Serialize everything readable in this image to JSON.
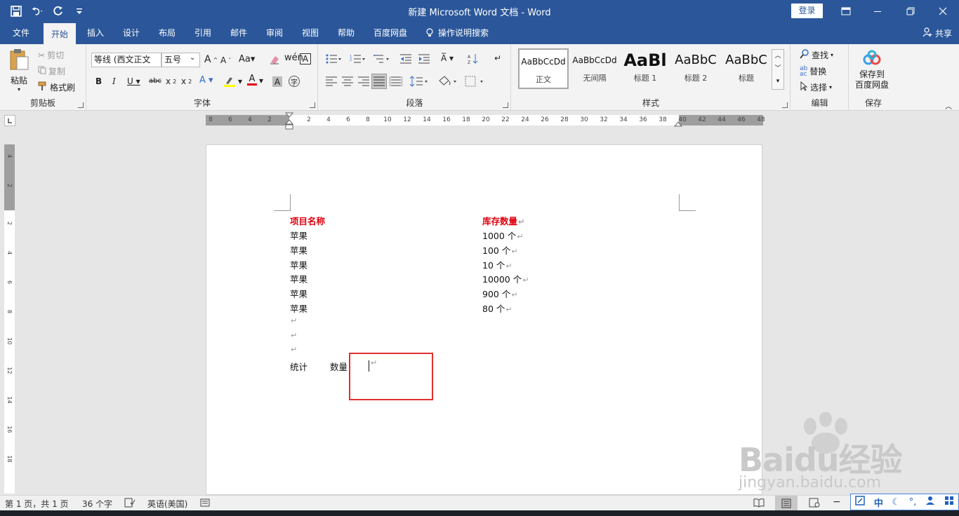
{
  "window": {
    "title": "新建 Microsoft Word 文档  -  Word",
    "login": "登录"
  },
  "tabs": [
    {
      "label": "文件"
    },
    {
      "label": "开始"
    },
    {
      "label": "插入"
    },
    {
      "label": "设计"
    },
    {
      "label": "布局"
    },
    {
      "label": "引用"
    },
    {
      "label": "邮件"
    },
    {
      "label": "审阅"
    },
    {
      "label": "视图"
    },
    {
      "label": "帮助"
    },
    {
      "label": "百度网盘"
    },
    {
      "label": "操作说明搜索"
    }
  ],
  "share": "共享",
  "ribbon": {
    "clipboard": {
      "label": "剪贴板",
      "paste": "粘贴",
      "cut": "剪切",
      "copy": "复制",
      "format_painter": "格式刷"
    },
    "font": {
      "label": "字体",
      "font_name": "等线 (西文正文",
      "font_size": "五号"
    },
    "paragraph": {
      "label": "段落"
    },
    "styles": {
      "label": "样式",
      "items": [
        {
          "preview": "AaBbCcDd",
          "name": "正文"
        },
        {
          "preview": "AaBbCcDd",
          "name": "无间隔"
        },
        {
          "preview": "AaBl",
          "name": "标题 1"
        },
        {
          "preview": "AaBbC",
          "name": "标题 2"
        },
        {
          "preview": "AaBbC",
          "name": "标题"
        }
      ]
    },
    "editing": {
      "label": "编辑",
      "find": "查找",
      "replace": "替换",
      "select": "选择"
    },
    "save": {
      "label": "保存",
      "button_line1": "保存到",
      "button_line2": "百度网盘"
    }
  },
  "ruler": {
    "h_ticks": [
      "8",
      "6",
      "4",
      "2",
      "2",
      "4",
      "6",
      "8",
      "10",
      "12",
      "14",
      "16",
      "18",
      "20",
      "22",
      "24",
      "26",
      "28",
      "30",
      "32",
      "34",
      "36",
      "38",
      "40",
      "42",
      "44",
      "46",
      "48"
    ],
    "v_ticks": [
      "4",
      "2",
      "2",
      "4",
      "6",
      "8",
      "10",
      "12",
      "14",
      "16",
      "18"
    ]
  },
  "document": {
    "headers": [
      "项目名称",
      "库存数量"
    ],
    "rows": [
      [
        "苹果",
        "1000 个"
      ],
      [
        "苹果",
        "100 个"
      ],
      [
        "苹果",
        "10 个"
      ],
      [
        "苹果",
        "10000 个"
      ],
      [
        "苹果",
        "900 个"
      ],
      [
        "苹果",
        "80 个"
      ]
    ],
    "summary_label": "统计",
    "summary_field": "数量"
  },
  "status_bar": {
    "page": "第 1 页，共 1 页",
    "words": "36 个字",
    "language": "英语(美国)"
  },
  "ime": {
    "mode": "中"
  },
  "watermark": {
    "brand": "Baidu经验",
    "url": "jingyan.baidu.com"
  },
  "colors": {
    "accent": "#2b579a",
    "heading_red": "#e0000f",
    "highlight_box": "#e0302f"
  }
}
